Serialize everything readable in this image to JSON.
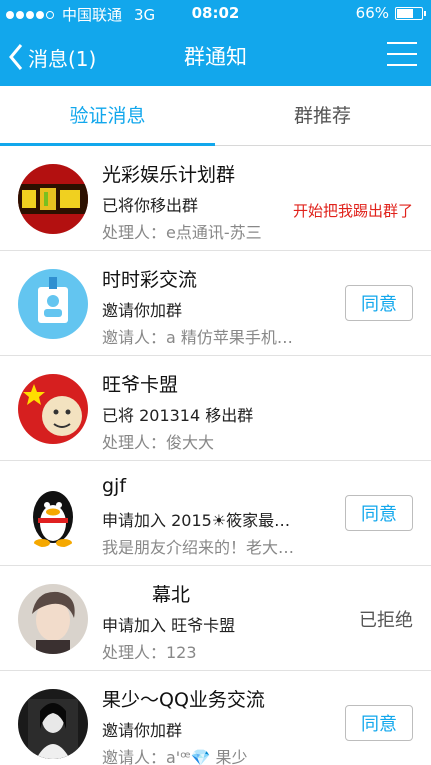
{
  "status_bar": {
    "carrier": "中国联通",
    "network": "3G",
    "time": "08:02",
    "battery": "66%",
    "battery_level": 0.66
  },
  "nav": {
    "back_label": "消息(1)",
    "title": "群通知"
  },
  "tabs": [
    {
      "label": "验证消息",
      "active": true
    },
    {
      "label": "群推荐",
      "active": false
    }
  ],
  "annotation": "开始把我踢出群了",
  "items": [
    {
      "title": "光彩娱乐计划群",
      "line2": "已将你移出群",
      "line3": "处理人：e点通讯-苏三",
      "action": ""
    },
    {
      "title": "时时彩交流",
      "line2": "邀请你加群",
      "line3": "邀请人：a 精仿苹果手机…",
      "action": "同意"
    },
    {
      "title": "旺爷卡盟",
      "line2": "已将 201314 移出群",
      "line3": "处理人：俊大大",
      "action": ""
    },
    {
      "title": "gjf",
      "line2": "申请加入 2015☀筱家最…",
      "line3": "我是朋友介绍来的！老大…",
      "action": "同意"
    },
    {
      "title": "幕北",
      "line2": "申请加入 旺爷卡盟",
      "line3": "处理人：123",
      "action": "已拒绝"
    },
    {
      "title": "果少～QQ业务交流",
      "line2": "邀请你加群",
      "line3": "邀请人：a'ꟹ💎 果少",
      "action": "同意"
    }
  ]
}
